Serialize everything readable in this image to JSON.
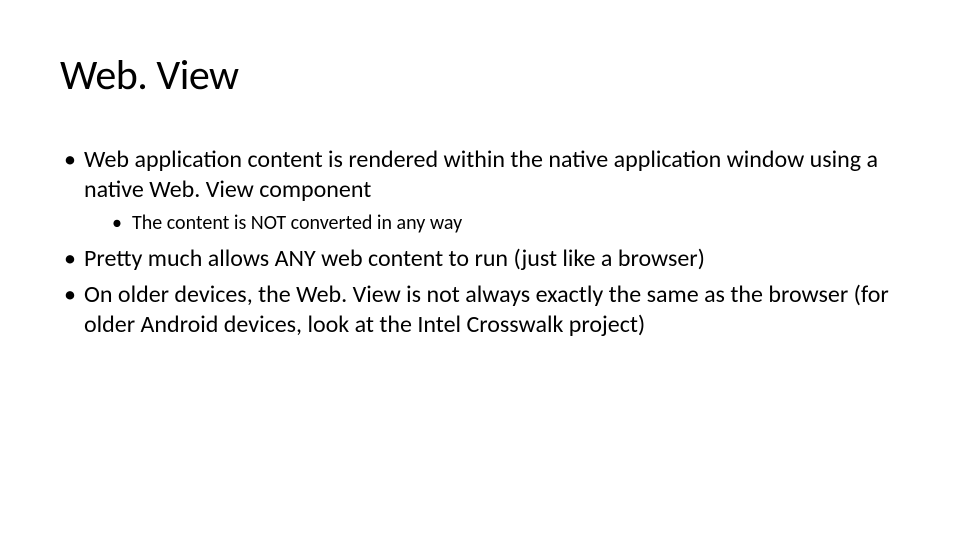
{
  "slide": {
    "title": "Web. View",
    "bullets": [
      {
        "text": "Web application content is rendered within the native application window using a native Web. View component",
        "sub": [
          {
            "text": "The content is NOT converted in any way"
          }
        ]
      },
      {
        "text": "Pretty much allows ANY web content to run (just like a browser)",
        "sub": []
      },
      {
        "text": "On older devices, the Web. View is not always exactly the same as the browser (for older Android devices, look at the Intel Crosswalk project)",
        "sub": []
      }
    ]
  }
}
